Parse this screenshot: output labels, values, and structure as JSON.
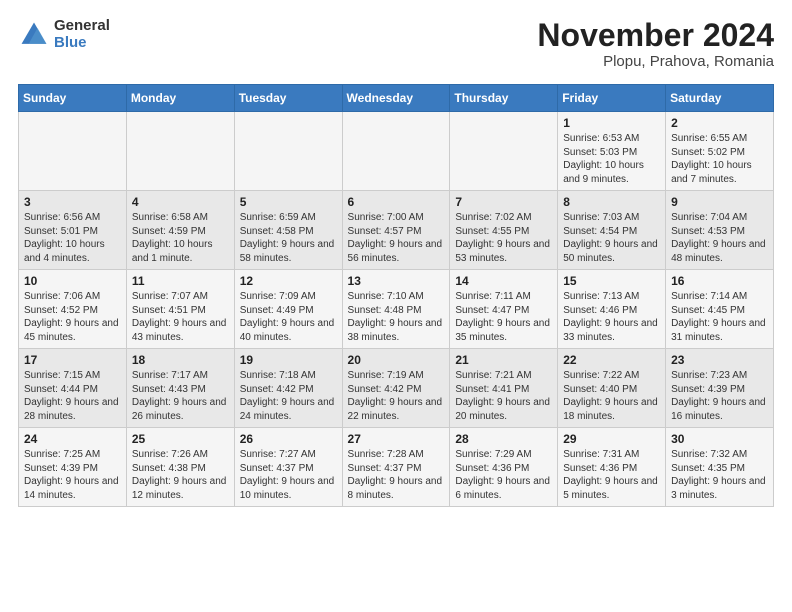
{
  "header": {
    "logo_line1": "General",
    "logo_line2": "Blue",
    "title": "November 2024",
    "subtitle": "Plopu, Prahova, Romania"
  },
  "days_of_week": [
    "Sunday",
    "Monday",
    "Tuesday",
    "Wednesday",
    "Thursday",
    "Friday",
    "Saturday"
  ],
  "weeks": [
    [
      {
        "day": "",
        "info": ""
      },
      {
        "day": "",
        "info": ""
      },
      {
        "day": "",
        "info": ""
      },
      {
        "day": "",
        "info": ""
      },
      {
        "day": "",
        "info": ""
      },
      {
        "day": "1",
        "info": "Sunrise: 6:53 AM\nSunset: 5:03 PM\nDaylight: 10 hours and 9 minutes."
      },
      {
        "day": "2",
        "info": "Sunrise: 6:55 AM\nSunset: 5:02 PM\nDaylight: 10 hours and 7 minutes."
      }
    ],
    [
      {
        "day": "3",
        "info": "Sunrise: 6:56 AM\nSunset: 5:01 PM\nDaylight: 10 hours and 4 minutes."
      },
      {
        "day": "4",
        "info": "Sunrise: 6:58 AM\nSunset: 4:59 PM\nDaylight: 10 hours and 1 minute."
      },
      {
        "day": "5",
        "info": "Sunrise: 6:59 AM\nSunset: 4:58 PM\nDaylight: 9 hours and 58 minutes."
      },
      {
        "day": "6",
        "info": "Sunrise: 7:00 AM\nSunset: 4:57 PM\nDaylight: 9 hours and 56 minutes."
      },
      {
        "day": "7",
        "info": "Sunrise: 7:02 AM\nSunset: 4:55 PM\nDaylight: 9 hours and 53 minutes."
      },
      {
        "day": "8",
        "info": "Sunrise: 7:03 AM\nSunset: 4:54 PM\nDaylight: 9 hours and 50 minutes."
      },
      {
        "day": "9",
        "info": "Sunrise: 7:04 AM\nSunset: 4:53 PM\nDaylight: 9 hours and 48 minutes."
      }
    ],
    [
      {
        "day": "10",
        "info": "Sunrise: 7:06 AM\nSunset: 4:52 PM\nDaylight: 9 hours and 45 minutes."
      },
      {
        "day": "11",
        "info": "Sunrise: 7:07 AM\nSunset: 4:51 PM\nDaylight: 9 hours and 43 minutes."
      },
      {
        "day": "12",
        "info": "Sunrise: 7:09 AM\nSunset: 4:49 PM\nDaylight: 9 hours and 40 minutes."
      },
      {
        "day": "13",
        "info": "Sunrise: 7:10 AM\nSunset: 4:48 PM\nDaylight: 9 hours and 38 minutes."
      },
      {
        "day": "14",
        "info": "Sunrise: 7:11 AM\nSunset: 4:47 PM\nDaylight: 9 hours and 35 minutes."
      },
      {
        "day": "15",
        "info": "Sunrise: 7:13 AM\nSunset: 4:46 PM\nDaylight: 9 hours and 33 minutes."
      },
      {
        "day": "16",
        "info": "Sunrise: 7:14 AM\nSunset: 4:45 PM\nDaylight: 9 hours and 31 minutes."
      }
    ],
    [
      {
        "day": "17",
        "info": "Sunrise: 7:15 AM\nSunset: 4:44 PM\nDaylight: 9 hours and 28 minutes."
      },
      {
        "day": "18",
        "info": "Sunrise: 7:17 AM\nSunset: 4:43 PM\nDaylight: 9 hours and 26 minutes."
      },
      {
        "day": "19",
        "info": "Sunrise: 7:18 AM\nSunset: 4:42 PM\nDaylight: 9 hours and 24 minutes."
      },
      {
        "day": "20",
        "info": "Sunrise: 7:19 AM\nSunset: 4:42 PM\nDaylight: 9 hours and 22 minutes."
      },
      {
        "day": "21",
        "info": "Sunrise: 7:21 AM\nSunset: 4:41 PM\nDaylight: 9 hours and 20 minutes."
      },
      {
        "day": "22",
        "info": "Sunrise: 7:22 AM\nSunset: 4:40 PM\nDaylight: 9 hours and 18 minutes."
      },
      {
        "day": "23",
        "info": "Sunrise: 7:23 AM\nSunset: 4:39 PM\nDaylight: 9 hours and 16 minutes."
      }
    ],
    [
      {
        "day": "24",
        "info": "Sunrise: 7:25 AM\nSunset: 4:39 PM\nDaylight: 9 hours and 14 minutes."
      },
      {
        "day": "25",
        "info": "Sunrise: 7:26 AM\nSunset: 4:38 PM\nDaylight: 9 hours and 12 minutes."
      },
      {
        "day": "26",
        "info": "Sunrise: 7:27 AM\nSunset: 4:37 PM\nDaylight: 9 hours and 10 minutes."
      },
      {
        "day": "27",
        "info": "Sunrise: 7:28 AM\nSunset: 4:37 PM\nDaylight: 9 hours and 8 minutes."
      },
      {
        "day": "28",
        "info": "Sunrise: 7:29 AM\nSunset: 4:36 PM\nDaylight: 9 hours and 6 minutes."
      },
      {
        "day": "29",
        "info": "Sunrise: 7:31 AM\nSunset: 4:36 PM\nDaylight: 9 hours and 5 minutes."
      },
      {
        "day": "30",
        "info": "Sunrise: 7:32 AM\nSunset: 4:35 PM\nDaylight: 9 hours and 3 minutes."
      }
    ]
  ]
}
